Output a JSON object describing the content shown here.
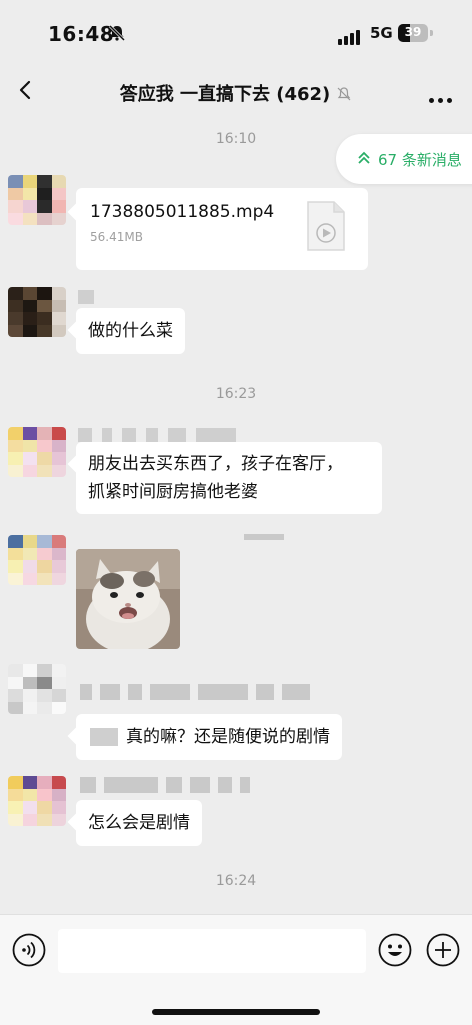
{
  "status_bar": {
    "time": "16:48",
    "network": "5G",
    "battery": "39",
    "battery_level": 0.39
  },
  "nav": {
    "title": "答应我 一直搞下去 (462)"
  },
  "new_messages": {
    "label": "67 条新消息",
    "color": "#2aae67"
  },
  "timestamps": [
    "16:10",
    "16:23",
    "16:24"
  ],
  "messages": [
    {
      "type": "file",
      "file_name": "1738805011885.mp4",
      "file_size": "56.41MB"
    },
    {
      "type": "text",
      "text": "做的什么菜"
    },
    {
      "type": "text",
      "text": "朋友出去买东西了，孩子在客厅，\n抓紧时间厨房搞他老婆"
    },
    {
      "type": "image",
      "description": "cat-sticker"
    },
    {
      "type": "text",
      "text": "真的嘛？还是随便说的剧情"
    },
    {
      "type": "text",
      "text": "怎么会是剧情"
    }
  ],
  "input": {
    "value": "",
    "placeholder": ""
  }
}
